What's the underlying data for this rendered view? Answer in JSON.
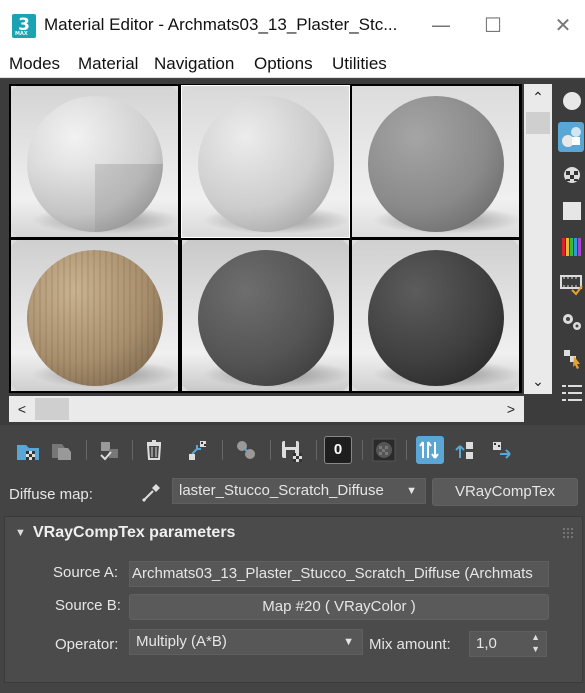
{
  "window": {
    "app_icon": {
      "digit": "3",
      "sub": "MAX"
    },
    "title": "Material Editor - Archmats03_13_Plaster_Stc...",
    "buttons": {
      "minimize": "—",
      "maximize": "☐",
      "close": "✕"
    }
  },
  "menu": [
    "Modes",
    "Material",
    "Navigation",
    "Options",
    "Utilities"
  ],
  "slots": [
    {
      "name": "white-quarter",
      "base": "#f2f2f2",
      "mid": "#cfcfcf",
      "dark": "#8e8e8e",
      "bg": "#d4d4d4",
      "selected": false
    },
    {
      "name": "white-plaster",
      "base": "#ececec",
      "mid": "#cdcdcd",
      "dark": "#939393",
      "bg": "#d9d9d9",
      "selected": true
    },
    {
      "name": "gray-concrete",
      "base": "#a5a5a5",
      "mid": "#8a8a8a",
      "dark": "#5e5e5e",
      "bg": "#dcdcdc",
      "selected": false
    },
    {
      "name": "wood",
      "base": "#c9b291",
      "mid": "#a78e6d",
      "dark": "#6d5a44",
      "bg": "#cfcfcf",
      "selected": false
    },
    {
      "name": "dark-gray",
      "base": "#6e6e6e",
      "mid": "#545454",
      "dark": "#333333",
      "bg": "#c9c9c9",
      "selected": false
    },
    {
      "name": "black-rough",
      "base": "#5c5c5c",
      "mid": "#3f3f3f",
      "dark": "#1f1f1f",
      "bg": "#d0d0d0",
      "selected": false
    }
  ],
  "scroll": {
    "up": "⌃",
    "down": "⌄",
    "left": "<",
    "right": ">"
  },
  "side_tools": [
    "sphere-icon",
    "cylinder-cube-icon",
    "checker-icon",
    "background-square-icon",
    "color-bars-icon",
    "video-check-icon",
    "material-options-icon",
    "select-by-material-icon",
    "material-map-navigator-icon"
  ],
  "toolbar": {
    "buttons": [
      "get-material-icon",
      "put-to-scene-icon",
      "assign-to-selection-icon",
      "delete-icon",
      "make-unique-icon",
      "copy-material-icon",
      "save-to-library-icon",
      "material-id-channel-icon",
      "show-map-in-viewport-icon",
      "show-end-result-icon",
      "go-to-parent-icon",
      "go-forward-icon"
    ],
    "material_id": "0"
  },
  "diffuse": {
    "label": "Diffuse map:",
    "map_name": "laster_Stucco_Scratch_Diffuse",
    "type_button": "VRayCompTex"
  },
  "rollout": {
    "title": "VRayCompTex parameters",
    "source_a_label": "Source A:",
    "source_a_value": "Archmats03_13_Plaster_Stucco_Scratch_Diffuse (Archmats",
    "source_b_label": "Source B:",
    "source_b_value": "Map #20  ( VRayColor )",
    "operator_label": "Operator:",
    "operator_value": "Multiply (A*B)",
    "mix_label": "Mix amount:",
    "mix_value": "1,0"
  },
  "colors": {
    "accent": "#5aa7d6",
    "panel": "#444444",
    "field": "#575757"
  }
}
